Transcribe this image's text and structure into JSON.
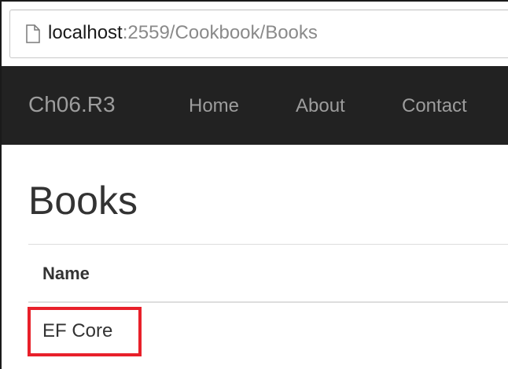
{
  "browser": {
    "url_host": "localhost",
    "url_rest": ":2559/Cookbook/Books",
    "page_icon": "page-icon"
  },
  "navbar": {
    "brand": "Ch06.R3",
    "links": [
      "Home",
      "About",
      "Contact"
    ]
  },
  "main": {
    "title": "Books",
    "table": {
      "headers": [
        "Name"
      ],
      "rows": [
        [
          "EF Core"
        ]
      ]
    },
    "highlight_color": "#e8202a"
  }
}
